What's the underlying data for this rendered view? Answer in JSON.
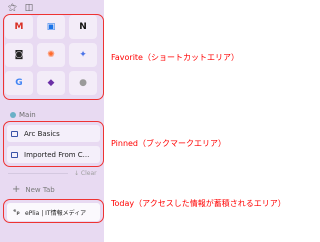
{
  "favorites": [
    {
      "icon": "gmail-icon",
      "glyph": "M",
      "color": "#d93025"
    },
    {
      "icon": "google-calendar-icon",
      "glyph": "▣",
      "color": "#1a73e8"
    },
    {
      "icon": "notion-icon",
      "glyph": "N",
      "color": "#111111"
    },
    {
      "icon": "app-icon-dark",
      "glyph": "◙",
      "color": "#222222"
    },
    {
      "icon": "app-icon-orange",
      "glyph": "✺",
      "color": "#ff6a2b"
    },
    {
      "icon": "sparkle-icon",
      "glyph": "✦",
      "color": "#4a73e8"
    },
    {
      "icon": "google-icon",
      "glyph": "G",
      "color": "#4285f4"
    },
    {
      "icon": "app-icon-purple",
      "glyph": "◆",
      "color": "#6b2fa6"
    },
    {
      "icon": "app-icon-gray",
      "glyph": "●",
      "color": "#9a9a9a"
    }
  ],
  "space_label": "Main",
  "pinned": [
    {
      "label": "Arc Basics"
    },
    {
      "label": "Imported From C..."
    }
  ],
  "clear_label": "↓ Clear",
  "new_tab_label": "New Tab",
  "today_tabs": [
    {
      "icon": "eplia-icon",
      "label": "ePlia | IT情報メディア"
    }
  ],
  "annotations": {
    "favorite": "Favorite（ショートカットエリア）",
    "pinned": "Pinned（ブックマークエリア）",
    "today": "Today（アクセスした情報が蓄積されるエリア）"
  },
  "colors": {
    "sidebar_bg": "#e8daf2",
    "annotation_red": "#ee3333"
  }
}
